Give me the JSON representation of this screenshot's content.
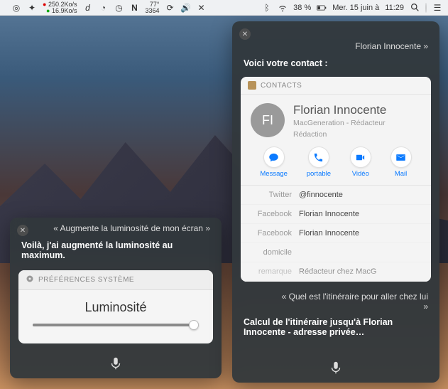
{
  "menubar": {
    "net_up": "250.2Ko/s",
    "net_down": "16.9Ko/s",
    "istat_d": "d",
    "notif_n": "N",
    "temp_high": "77°",
    "temp_low": "3364",
    "battery_pct": "38 %",
    "date": "Mer. 15 juin à",
    "time": "11:29"
  },
  "left_panel": {
    "query": "« Augmente la luminosité de mon écran »",
    "response": "Voilà, j'ai augmenté la luminosité au maximum.",
    "card_title": "PRÉFÉRENCES SYSTÈME",
    "control_label": "Luminosité"
  },
  "right_panel": {
    "query_trunc_line2": "Florian Innocente »",
    "response": "Voici votre contact :",
    "contacts_header": "CONTACTS",
    "avatar_initials": "FI",
    "name": "Florian Innocente",
    "sub1": "MacGeneration   -   Rédacteur",
    "sub2": "Rédaction",
    "actions": {
      "message": "Message",
      "portable": "portable",
      "video": "Vidéo",
      "mail": "Mail"
    },
    "fields": [
      {
        "k": "Twitter",
        "v": "@finnocente"
      },
      {
        "k": "Facebook",
        "v": "Florian Innocente"
      },
      {
        "k": "Facebook",
        "v": "Florian Innocente"
      },
      {
        "k": "domicile",
        "v": ""
      },
      {
        "k": "remarque",
        "v": "Rédacteur chez MacG"
      }
    ],
    "query2": "« Quel est l'itinéraire pour aller chez lui »",
    "response2": "Calcul de l'itinéraire jusqu'à Florian Innocente - adresse privée…"
  }
}
